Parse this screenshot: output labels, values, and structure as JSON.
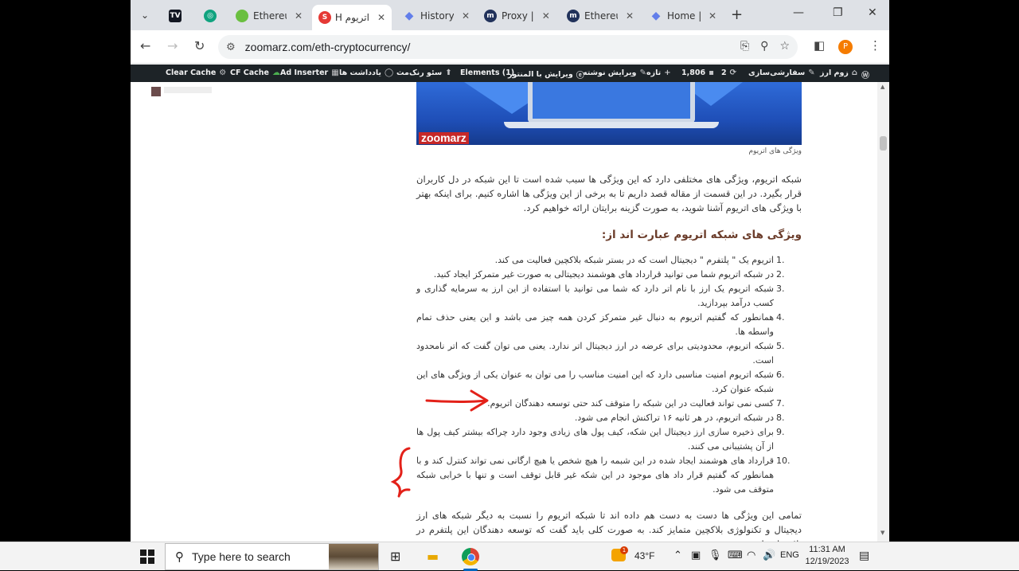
{
  "browser": {
    "tabs": [
      {
        "label": "",
        "favicon": "tradingview-icon",
        "color": "#131722"
      },
      {
        "label": "",
        "favicon": "chatgpt-icon",
        "color": "#10a37f"
      },
      {
        "label": "Ethereu",
        "favicon": "ethereum-green-icon",
        "color": "#6abf40"
      },
      {
        "label": "اتریوم H",
        "favicon": "zoomarz-icon",
        "color": "#e53935",
        "active": true
      },
      {
        "label": "History",
        "favicon": "ethereum-icon",
        "color": "#627eea"
      },
      {
        "label": "Proxy |",
        "favicon": "etherscan-icon",
        "color": "#21325b"
      },
      {
        "label": "Ethereu",
        "favicon": "etherscan-icon",
        "color": "#21325b"
      },
      {
        "label": "Home |",
        "favicon": "ethereum-icon",
        "color": "#627eea"
      }
    ],
    "url": "zoomarz.com/eth-cryptocurrency/",
    "profile_initial": "P"
  },
  "wpbar": {
    "items": [
      {
        "label": "زوم ارز",
        "icon": "home-icon"
      },
      {
        "label": "سفارشی‌سازی",
        "icon": "brush-icon"
      },
      {
        "label": "2",
        "icon": "refresh-icon"
      },
      {
        "label": "1,806",
        "icon": "comment-icon"
      },
      {
        "label": "تازه",
        "icon": "plus-icon"
      },
      {
        "label": "ویرایش نوشته",
        "icon": "pencil-icon"
      },
      {
        "label": "ویرایش با المنتور",
        "icon": "elementor-icon"
      },
      {
        "label": "Elements (1)",
        "icon": ""
      },
      {
        "label": "سئو رنک‌مث",
        "icon": "rankmath-icon"
      },
      {
        "label": "یادداشت ها",
        "icon": "note-icon"
      },
      {
        "label": "Ad Inserter",
        "icon": "ad-icon"
      },
      {
        "label": "CF Cache",
        "icon": "cloud-icon"
      },
      {
        "label": "Clear Cache",
        "icon": "gear-icon"
      }
    ]
  },
  "article": {
    "hero_logo": "zoomarz",
    "caption": "ویژگی های اتریوم",
    "intro": "شبکه اتریوم، ویژگی های مختلفی دارد که این ویژگی ها سبب شده است تا این شبکه در دل کاربران قرار بگیرد. در این قسمت از مقاله قصد داریم تا به برخی از این ویژگی ها اشاره کنیم. برای اینکه بهتر با ویژگی های اتریوم آشنا شوید، به صورت گزینه برایتان ارائه خواهیم کرد.",
    "heading": "ویژگی های شبکه اتریوم عبارت اند از:",
    "list": [
      {
        "num": "1.",
        "text": "اتریوم یک \" پلتفرم \" دیجیتال است که در بستر شبکه بلاکچین فعالیت می کند."
      },
      {
        "num": "2.",
        "text": "در شبکه اتریوم شما می توانید قرارداد های هوشمند دیجیتالی به صورت غیر متمرکز ایجاد کنید."
      },
      {
        "num": "3.",
        "text": "شبکه اتریوم یک ارز با نام اتر دارد که شما می توانید با استفاده از این ارز به سرمایه گذاری و کسب درآمد بپردازید."
      },
      {
        "num": "4.",
        "text": "همانطور که گفتیم اتریوم به دنبال غیر متمرکز کردن همه چیز می باشد و این یعنی حذف تمام واسطه ها."
      },
      {
        "num": "5.",
        "text": "شبکه اتریوم، محدودیتی برای عرضه در ارز دیجیتال اتر ندارد. یعنی می توان گفت که اتر نامحدود است."
      },
      {
        "num": "6.",
        "text": "شبکه اتریوم امنیت مناسبی دارد که این امنیت مناسب را می توان به عنوان یکی از ویژگی های این شبکه عنوان کرد."
      },
      {
        "num": "7.",
        "text": "کسی نمی تواند فعالیت در این شبکه را متوقف کند حتی توسعه دهندگان اتریوم."
      },
      {
        "num": "8.",
        "text": "در شبکه اتریوم، در هر ثانیه ۱۶ تراکنش انجام می شود."
      },
      {
        "num": "9.",
        "text": "برای ذخیره سازی ارز دیجیتال این شکه، کیف پول های زیادی وجود دارد چراکه بیشتر کیف پول ها از آن پشتیبانی می کنند."
      },
      {
        "num": "10.",
        "text": "قرارداد های هوشمند ایجاد شده در این شبمه را هیچ شخص یا هیچ ارگانی نمی تواند کنترل کند و با همانطور که گفتیم قرار داد های موجود در این شکه غیر قابل توقف است و تنها با خرابی شبکه متوقف می شود."
      }
    ],
    "closing": "تمامی این ویژگی ها دست به دست هم داده اند تا شبکه اتریوم را نسبت به دیگر شبکه های ارز دیجیتال و تکنولوژی بلاکچین متمایز کند. به صورت کلی باید گفت که توسعه دهندگان این پلتفرم در تلاش اند تا"
  },
  "taskbar": {
    "search_placeholder": "Type here to search",
    "weather_badge": "1",
    "temperature": "43°F",
    "language": "ENG",
    "time": "11:31 AM",
    "date": "12/19/2023"
  }
}
